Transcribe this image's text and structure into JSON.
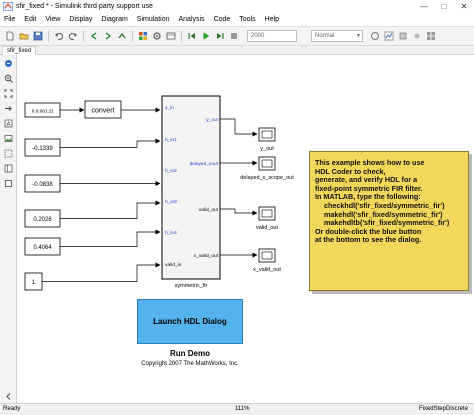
{
  "window": {
    "title": "sfir_fixed * - Simulink third party support use"
  },
  "menu": [
    "File",
    "Edit",
    "View",
    "Display",
    "Diagram",
    "Simulation",
    "Analysis",
    "Code",
    "Tools",
    "Help"
  ],
  "toolbar": {
    "stop_time": "2000",
    "sim_mode": "Normal"
  },
  "tab": {
    "label": "sfir_fixed"
  },
  "blocks": {
    "source_top": "0.0:001:2)",
    "convert": "convert",
    "h0": "-0.1339",
    "h1": "-0.0838",
    "h2": "0.2026",
    "h3": "0.4064",
    "one": "1",
    "fir": {
      "label": "symmetric_fir",
      "inputs": [
        "x_in",
        "h_in1",
        "h_in2",
        "h_in3",
        "h_in4",
        "valid_in"
      ],
      "outputs": [
        "y_out",
        "delayed_xout",
        "valid_out",
        "x_valid_out"
      ]
    },
    "scopes": [
      "y_out",
      "delayed_x_scope_out",
      "valid_out",
      "x_valid_out"
    ]
  },
  "note": {
    "lines": [
      "This example shows how to use",
      "HDL Coder to check,",
      "generate, and verify HDL for a",
      "fixed-point symmetric FIR filter.",
      "In MATLAB, type the following:",
      "checkhdl('sfir_fixed/symmetric_fir')",
      "makehdl('sfir_fixed/symmetric_fir')",
      "makehdltb('sfir_fixed/symmetric_fir')",
      "Or double-click the blue button",
      "at the bottom to see the dialog."
    ]
  },
  "launch_button": "Launch HDL Dialog",
  "run_demo": "Run Demo",
  "copyright": "Copyright 2007 The MathWorks, Inc.",
  "status": {
    "left": "Ready",
    "zoom": "111%",
    "solver": "FixedStepDiscrete"
  },
  "colors": {
    "note_bg": "#f3d75a",
    "button_bg": "#54b3ec",
    "port_label": "#1a3cc8"
  }
}
